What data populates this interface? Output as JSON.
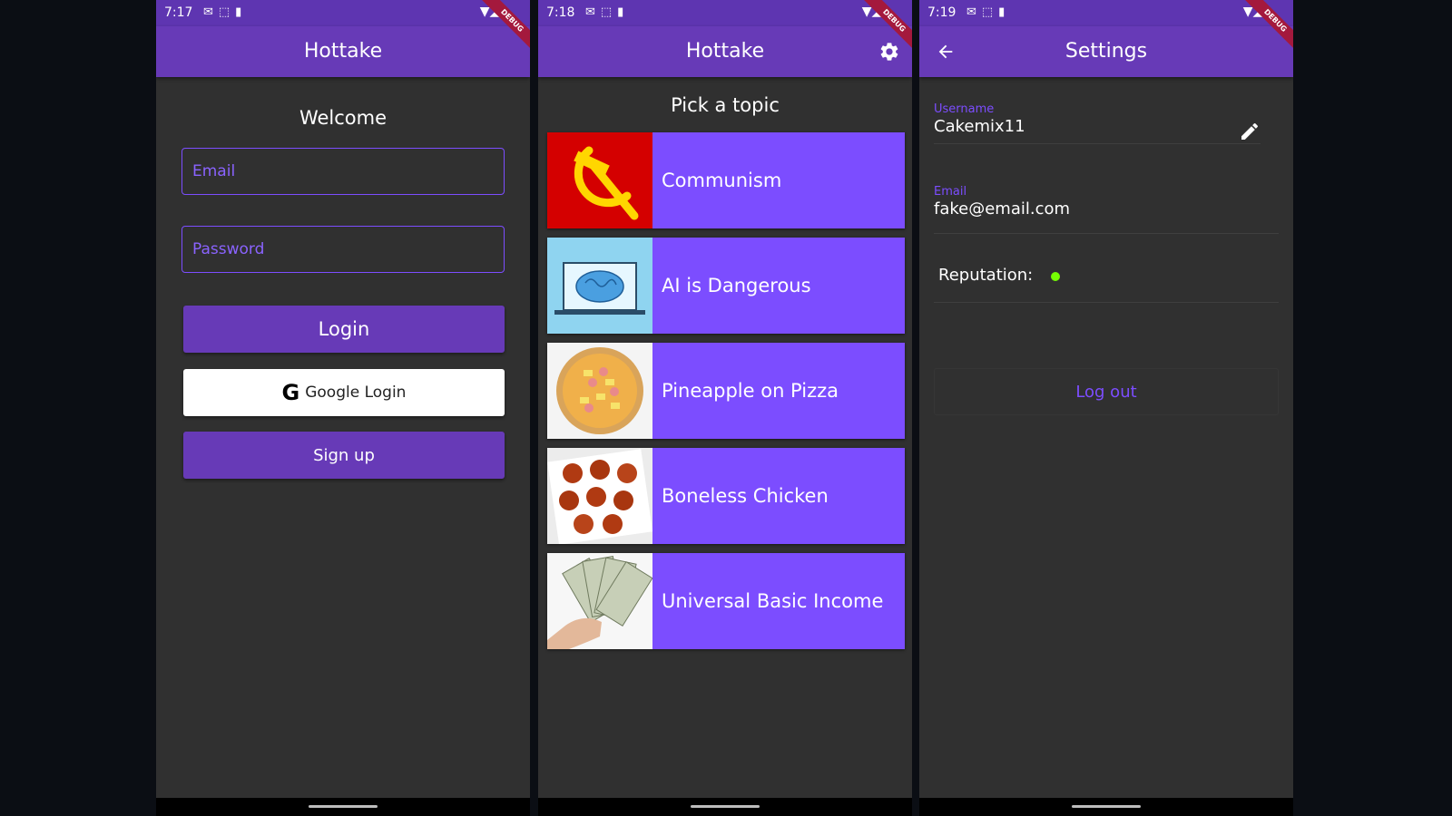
{
  "colors": {
    "primary": "#673ab7",
    "accent": "#7c4dff",
    "background": "#303030",
    "status_bar": "#5e35b1",
    "reputation_dot": "#76ff03"
  },
  "screens": [
    {
      "status_time": "7:17",
      "title": "Hottake",
      "heading": "Welcome",
      "email_placeholder": "Email",
      "password_placeholder": "Password",
      "login_label": "Login",
      "google_label": "Google Login",
      "signup_label": "Sign up",
      "debug_label": "DEBUG"
    },
    {
      "status_time": "7:18",
      "title": "Hottake",
      "heading": "Pick a topic",
      "settings_icon": "gear-icon",
      "debug_label": "DEBUG",
      "topics": [
        {
          "label": "Communism",
          "image": "hammer-sickle-flag"
        },
        {
          "label": "AI is Dangerous",
          "image": "laptop-brain"
        },
        {
          "label": "Pineapple on Pizza",
          "image": "pizza"
        },
        {
          "label": "Boneless Chicken",
          "image": "chicken-wings"
        },
        {
          "label": "Universal Basic Income",
          "image": "money-in-hand"
        }
      ]
    },
    {
      "status_time": "7:19",
      "title": "Settings",
      "back_icon": "arrow-back-icon",
      "debug_label": "DEBUG",
      "username_label": "Username",
      "username": "Cakemix11",
      "email_label": "Email",
      "email": "fake@email.com",
      "reputation_label": "Reputation:",
      "logout_label": "Log out"
    }
  ]
}
